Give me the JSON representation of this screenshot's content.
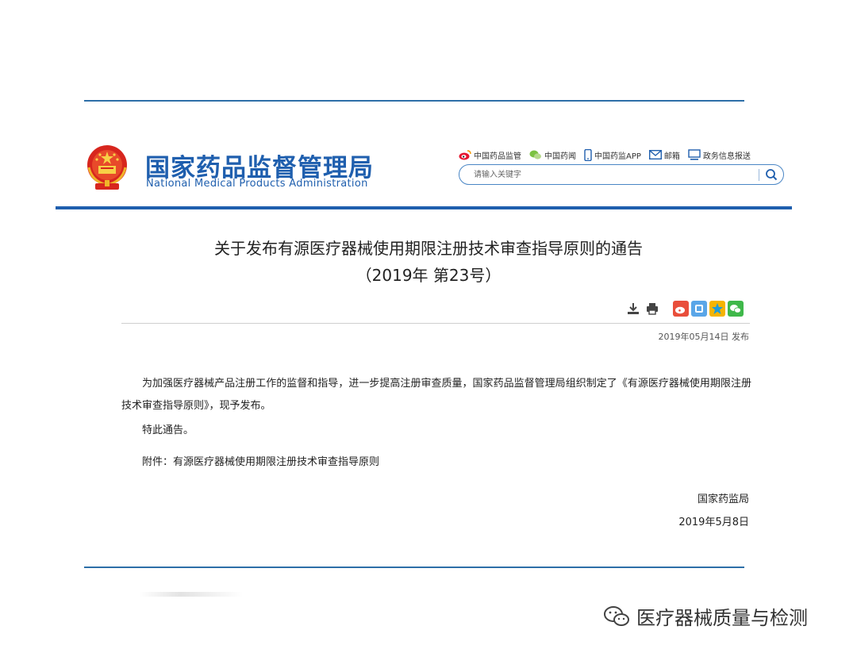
{
  "header": {
    "brand_cn": "国家药品监督管理局",
    "brand_en": "National Medical Products Administration",
    "toplinks": [
      {
        "label": "中国药品监管",
        "icon": "weibo-icon"
      },
      {
        "label": "中国药闻",
        "icon": "wechat-icon"
      },
      {
        "label": "中国药监APP",
        "icon": "mobile-icon"
      },
      {
        "label": "邮箱",
        "icon": "mail-icon"
      },
      {
        "label": "政务信息报送",
        "icon": "monitor-icon"
      }
    ],
    "search": {
      "placeholder": "请输入关键字"
    }
  },
  "article": {
    "title_line1": "关于发布有源医疗器械使用期限注册技术审查指导原则的通告",
    "title_line2": "（2019年 第23号）",
    "publish_date": "2019年05月14日 发布",
    "paragraph1": "为加强医疗器械产品注册工作的监督和指导，进一步提高注册审查质量，国家药品监督管理局组织制定了《有源医疗器械使用期限注册技术审查指导原则》，现予发布。",
    "paragraph2": "特此通告。",
    "attachment": "附件：有源医疗器械使用期限注册技术审查指导原则",
    "signer": "国家药监局",
    "sign_date": "2019年5月8日"
  },
  "watermark": {
    "text": "医疗器械质量与检测"
  },
  "colors": {
    "brand_blue": "#1f5fae",
    "rule_blue": "#2d6fa8"
  }
}
